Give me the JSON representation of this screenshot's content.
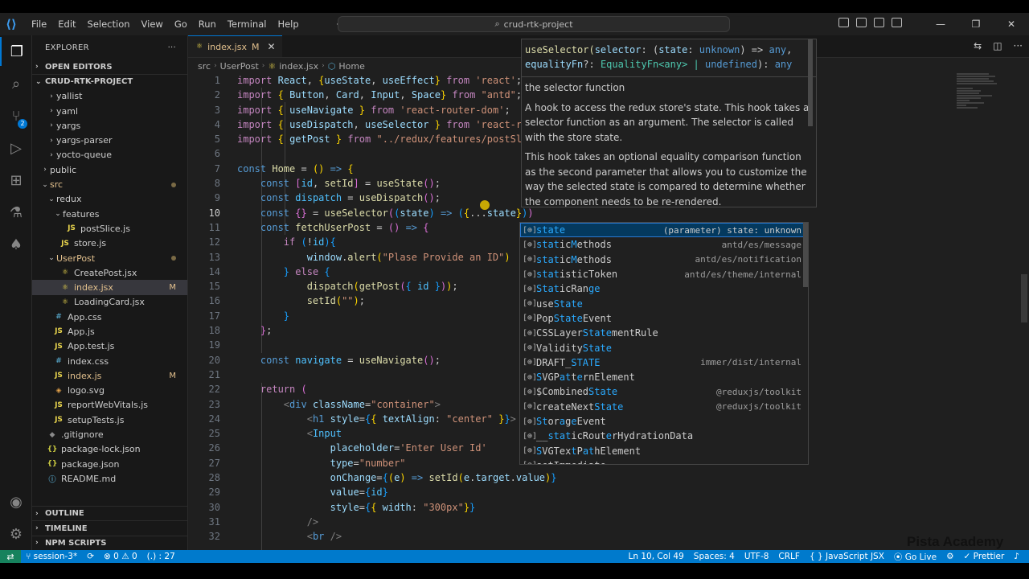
{
  "window": {
    "menu": [
      "File",
      "Edit",
      "Selection",
      "View",
      "Go",
      "Run",
      "Terminal",
      "Help"
    ],
    "search_text": "crud-rtk-project",
    "controls": [
      "—",
      "❐",
      "✕"
    ]
  },
  "activity": {
    "scm_badge": "2"
  },
  "sidebar": {
    "title": "EXPLORER",
    "more": "···",
    "open_editors": "OPEN EDITORS",
    "project": "CRUD-RTK-PROJECT",
    "tree": [
      {
        "label": "yallist",
        "depth": 2,
        "type": "folder",
        "open": false
      },
      {
        "label": "yaml",
        "depth": 2,
        "type": "folder",
        "open": false
      },
      {
        "label": "yargs",
        "depth": 2,
        "type": "folder",
        "open": false
      },
      {
        "label": "yargs-parser",
        "depth": 2,
        "type": "folder",
        "open": false
      },
      {
        "label": "yocto-queue",
        "depth": 2,
        "type": "folder",
        "open": false
      },
      {
        "label": "public",
        "depth": 1,
        "type": "folder",
        "open": false
      },
      {
        "label": "src",
        "depth": 1,
        "type": "folder",
        "open": true,
        "modified": true,
        "dot": true
      },
      {
        "label": "redux",
        "depth": 2,
        "type": "folder",
        "open": true
      },
      {
        "label": "features",
        "depth": 3,
        "type": "folder",
        "open": true
      },
      {
        "label": "postSlice.js",
        "depth": 4,
        "type": "js"
      },
      {
        "label": "store.js",
        "depth": 3,
        "type": "js"
      },
      {
        "label": "UserPost",
        "depth": 2,
        "type": "folder",
        "open": true,
        "modified": true,
        "dot": true
      },
      {
        "label": "CreatePost.jsx",
        "depth": 3,
        "type": "jsx"
      },
      {
        "label": "index.jsx",
        "depth": 3,
        "type": "jsx",
        "selected": true,
        "modified": true,
        "git": "M"
      },
      {
        "label": "LoadingCard.jsx",
        "depth": 3,
        "type": "jsx"
      },
      {
        "label": "App.css",
        "depth": 2,
        "type": "css"
      },
      {
        "label": "App.js",
        "depth": 2,
        "type": "js"
      },
      {
        "label": "App.test.js",
        "depth": 2,
        "type": "js"
      },
      {
        "label": "index.css",
        "depth": 2,
        "type": "css"
      },
      {
        "label": "index.js",
        "depth": 2,
        "type": "js",
        "modified": true,
        "git": "M"
      },
      {
        "label": "logo.svg",
        "depth": 2,
        "type": "svg"
      },
      {
        "label": "reportWebVitals.js",
        "depth": 2,
        "type": "js"
      },
      {
        "label": "setupTests.js",
        "depth": 2,
        "type": "js"
      },
      {
        "label": ".gitignore",
        "depth": 1,
        "type": "git"
      },
      {
        "label": "package-lock.json",
        "depth": 1,
        "type": "json"
      },
      {
        "label": "package.json",
        "depth": 1,
        "type": "json"
      },
      {
        "label": "README.md",
        "depth": 1,
        "type": "info"
      }
    ],
    "outline": "OUTLINE",
    "timeline": "TIMELINE",
    "npm_scripts": "NPM SCRIPTS"
  },
  "editor": {
    "tab_label": "index.jsx",
    "tab_git": "M",
    "breadcrumb": [
      "src",
      "UserPost",
      "index.jsx",
      "Home"
    ],
    "current_line": 10,
    "line_numbers": [
      "1",
      "2",
      "3",
      "4",
      "5",
      "6",
      "7",
      "8",
      "9",
      "10",
      "11",
      "12",
      "13",
      "14",
      "15",
      "16",
      "17",
      "18",
      "19",
      "20",
      "21",
      "22",
      "23",
      "24",
      "25",
      "26",
      "27",
      "28",
      "29",
      "30",
      "31",
      "32"
    ]
  },
  "hover": {
    "sig_fn": "useSelector(",
    "sig_param": "selector",
    "sig_rest1": ": (",
    "sig_state": "state",
    "sig_rest2": ": ",
    "sig_unknown": "unknown",
    "sig_rest3": ") => ",
    "sig_any": "any",
    "sig_line2_a": "equalityFn",
    "sig_line2_b": "?: ",
    "sig_line2_c": "EqualityFn<any> | ",
    "sig_line2_d": "undefined",
    "sig_line2_e": "): ",
    "sig_line2_f": "any",
    "doc": [
      "the selector function",
      "A hook to access the redux store's state. This hook takes a selector function as an argument. The selector is called with the store state.",
      "This hook takes an optional equality comparison function as the second parameter that allows you to customize the way the selected state is compared to determine whether the component needs to be re-rendered."
    ]
  },
  "suggest": [
    {
      "icon": "[⊕]",
      "parts": [
        [
          "hl",
          "state"
        ]
      ],
      "detail": "(parameter) state: unknown",
      "focused": true
    },
    {
      "icon": "[⊕]",
      "parts": [
        [
          "hl",
          "stat"
        ],
        [
          "n",
          "ic"
        ],
        [
          "hl",
          "M"
        ],
        [
          "n",
          "ethods"
        ]
      ],
      "detail": "antd/es/message"
    },
    {
      "icon": "[⊕]",
      "parts": [
        [
          "hl",
          "stat"
        ],
        [
          "n",
          "ic"
        ],
        [
          "hl",
          "M"
        ],
        [
          "n",
          "ethods"
        ]
      ],
      "detail": "antd/es/notification"
    },
    {
      "icon": "[⊕]",
      "parts": [
        [
          "hl",
          "stat"
        ],
        [
          "n",
          "is"
        ],
        [
          "n",
          "ticToken"
        ]
      ],
      "detail": "antd/es/theme/internal"
    },
    {
      "icon": "[⊕]",
      "parts": [
        [
          "hl",
          "Stat"
        ],
        [
          "n",
          "icRan"
        ],
        [
          "hl",
          "ge"
        ]
      ],
      "detail": ""
    },
    {
      "icon": "[⊕]",
      "parts": [
        [
          "n",
          "use"
        ],
        [
          "hl",
          "State"
        ]
      ],
      "detail": ""
    },
    {
      "icon": "[⊕]",
      "parts": [
        [
          "n",
          "Pop"
        ],
        [
          "hl",
          "State"
        ],
        [
          "n",
          "Event"
        ]
      ],
      "detail": ""
    },
    {
      "icon": "[⊕]",
      "parts": [
        [
          "n",
          "CSSLayer"
        ],
        [
          "hl",
          "State"
        ],
        [
          "n",
          "mentRule"
        ]
      ],
      "detail": ""
    },
    {
      "icon": "[⊕]",
      "parts": [
        [
          "n",
          "Validity"
        ],
        [
          "hl",
          "State"
        ]
      ],
      "detail": ""
    },
    {
      "icon": "[⊕]",
      "parts": [
        [
          "n",
          "DRAFT_"
        ],
        [
          "hl",
          "STATE"
        ]
      ],
      "detail": "immer/dist/internal"
    },
    {
      "icon": "[⊕]",
      "parts": [
        [
          "hl",
          "S"
        ],
        [
          "n",
          "VGP"
        ],
        [
          "hl",
          "at"
        ],
        [
          "n",
          "t"
        ],
        [
          "hl",
          "e"
        ],
        [
          "n",
          "rnElement"
        ]
      ],
      "detail": ""
    },
    {
      "icon": "[⊕]",
      "parts": [
        [
          "n",
          "$Combined"
        ],
        [
          "hl",
          "State"
        ]
      ],
      "detail": "@reduxjs/toolkit"
    },
    {
      "icon": "[⊕]",
      "parts": [
        [
          "n",
          "createNext"
        ],
        [
          "hl",
          "State"
        ]
      ],
      "detail": "@reduxjs/toolkit"
    },
    {
      "icon": "[⊕]",
      "parts": [
        [
          "hl",
          "St"
        ],
        [
          "n",
          "or"
        ],
        [
          "hl",
          "a"
        ],
        [
          "n",
          "g"
        ],
        [
          "hl",
          "e"
        ],
        [
          "n",
          "Event"
        ]
      ],
      "detail": ""
    },
    {
      "icon": "[⊕]",
      "parts": [
        [
          "n",
          "__"
        ],
        [
          "hl",
          "stat"
        ],
        [
          "n",
          "icRout"
        ],
        [
          "hl",
          "e"
        ],
        [
          "n",
          "rHydrationData"
        ]
      ],
      "detail": ""
    },
    {
      "icon": "[⊕]",
      "parts": [
        [
          "hl",
          "S"
        ],
        [
          "n",
          "VGTex"
        ],
        [
          "hl",
          "t"
        ],
        [
          "n",
          "P"
        ],
        [
          "hl",
          "at"
        ],
        [
          "n",
          "hElement"
        ]
      ],
      "detail": ""
    },
    {
      "icon": "[⊕]",
      "parts": [
        [
          "n",
          "setImmediate"
        ]
      ],
      "detail": ""
    }
  ],
  "statusbar": {
    "remote": "⇄",
    "branch": "session-3*",
    "sync": "⟳",
    "problems": "⊗ 0 ⚠ 0",
    "selection": "(.) : 27",
    "position": "Ln 10, Col 49",
    "spaces": "Spaces: 4",
    "encoding": "UTF-8",
    "eol": "CRLF",
    "language": "{ } JavaScript JSX",
    "golive": "Go Live",
    "prettier": "✓ Prettier",
    "bell": "🔔"
  },
  "watermark": "Pista Academy",
  "colors": {
    "accent": "#007acc",
    "editor_bg": "#1f1f1f",
    "sidebar_bg": "#181818",
    "modified": "#e2c08d",
    "suggest_highlight": "#2aaaff"
  }
}
